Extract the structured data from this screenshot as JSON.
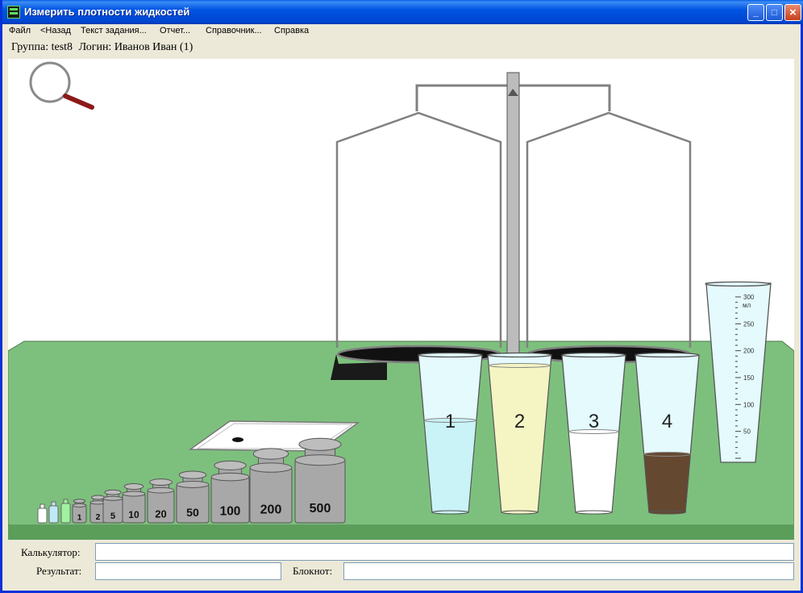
{
  "window": {
    "title": "Измерить плотности жидкостей"
  },
  "menu": {
    "items": [
      {
        "label": "Файл"
      },
      {
        "label": "<Назад"
      },
      {
        "label": "Текст задания..."
      },
      {
        "label": "Отчет..."
      },
      {
        "label": "Справочник..."
      },
      {
        "label": "Справка"
      }
    ]
  },
  "info": {
    "group_label": "Группа: test8",
    "login_label": "Логин: Иванов Иван (1)"
  },
  "scene": {
    "colors": {
      "table": "#7DC07D",
      "table_edge": "#5A9E5A",
      "liquid1": "#C9F3F7",
      "liquid2": "#F5F5C4",
      "liquid3": "#FFFFFF",
      "liquid4": "#654830"
    },
    "beakers": [
      {
        "label": "1"
      },
      {
        "label": "2"
      },
      {
        "label": "3"
      },
      {
        "label": "4"
      }
    ],
    "weights": [
      {
        "label": "1"
      },
      {
        "label": "2"
      },
      {
        "label": "5"
      },
      {
        "label": "10"
      },
      {
        "label": "20"
      },
      {
        "label": "50"
      },
      {
        "label": "100"
      },
      {
        "label": "200"
      },
      {
        "label": "500"
      }
    ],
    "cylinder": {
      "unit": "мл",
      "ticks": [
        {
          "label": "300"
        },
        {
          "label": "250"
        },
        {
          "label": "200"
        },
        {
          "label": "150"
        },
        {
          "label": "100"
        },
        {
          "label": "50"
        }
      ]
    }
  },
  "bottom": {
    "calculator_label": "Калькулятор:",
    "calculator_value": "",
    "result_label": "Результат:",
    "result_value": "",
    "notepad_label": "Блокнот:",
    "notepad_value": ""
  }
}
